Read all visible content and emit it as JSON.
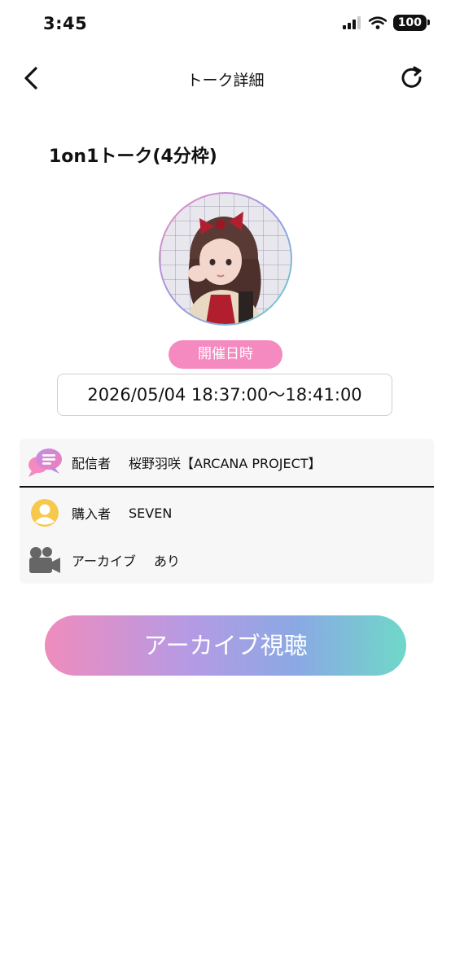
{
  "status_bar": {
    "time": "3:45",
    "battery": "100"
  },
  "header": {
    "title": "トーク詳細"
  },
  "talk": {
    "title": "1on1トーク(4分枠)"
  },
  "schedule": {
    "label": "開催日時",
    "datetime": "2026/05/04 18:37:00〜18:41:00"
  },
  "info": {
    "streamer_label": "配信者",
    "streamer_value": "桜野羽咲【ARCANA PROJECT】",
    "buyer_label": "購入者",
    "buyer_value": "SEVEN",
    "archive_label": "アーカイブ",
    "archive_value": "あり"
  },
  "actions": {
    "archive_button": "アーカイブ視聴"
  },
  "colors": {
    "pink": "#f58ac0",
    "purple": "#b59ae4",
    "teal": "#6fd8c8",
    "yellow": "#f6c94c",
    "gray_icon": "#666666"
  }
}
